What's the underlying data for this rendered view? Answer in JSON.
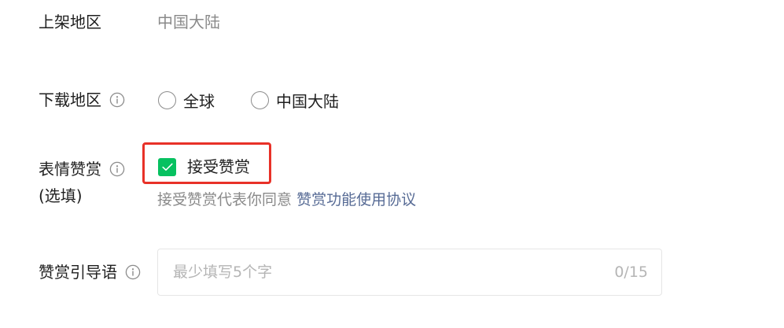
{
  "shelf_region": {
    "label": "上架地区",
    "value": "中国大陆"
  },
  "download_region": {
    "label": "下载地区",
    "info_icon": "info-circle-icon",
    "options": [
      {
        "label": "全球",
        "checked": false
      },
      {
        "label": "中国大陆",
        "checked": false
      }
    ]
  },
  "sticker_reward": {
    "label": "表情赞赏",
    "sub_label": "(选填)",
    "info_icon": "info-circle-icon",
    "checkbox_label": "接受赞赏",
    "checked": true,
    "helper_text": "接受赞赏代表你同意",
    "helper_link": "赞赏功能使用协议",
    "accent_color": "#07c160",
    "highlight_color": "#e83128",
    "link_color": "#576b95"
  },
  "reward_prompt": {
    "label": "赞赏引导语",
    "info_icon": "info-circle-icon",
    "placeholder": "最少填写5个字",
    "value": "",
    "counter": "0/15"
  }
}
